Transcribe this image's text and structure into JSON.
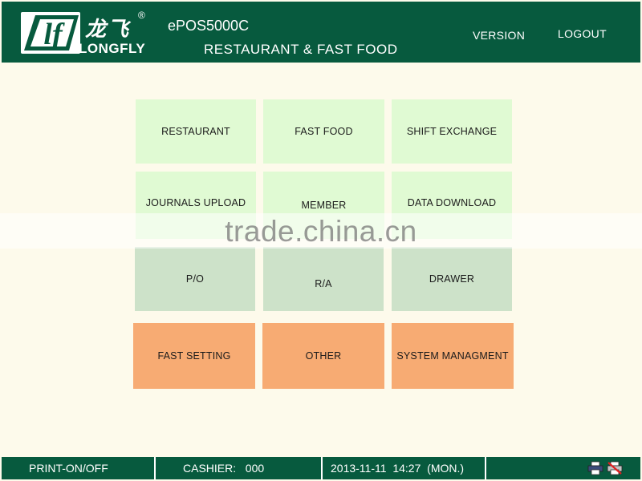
{
  "header": {
    "logo_letter": "lf",
    "logo_cn": "龙飞",
    "logo_reg": "®",
    "logo_en": "LONGFLY",
    "product": "ePOS5000C",
    "subtitle": "RESTAURANT & FAST FOOD",
    "version_label": "VERSION",
    "logout_label": "LOGOUT"
  },
  "menu": {
    "restaurant": "RESTAURANT",
    "fast_food": "FAST FOOD",
    "shift_exchange": "SHIFT EXCHANGE",
    "journals_upload": "JOURNALS UPLOAD",
    "member": "MEMBER",
    "data_download": "DATA DOWNLOAD",
    "po": "P/O",
    "ra": "R/A",
    "drawer": "DRAWER",
    "fast_setting": "FAST SETTING",
    "other": "OTHER",
    "system_management": "SYSTEM MANAGMENT"
  },
  "watermark": "trade.china.cn",
  "footer": {
    "print_label": "PRINT-ON/OFF",
    "cashier_label": "CASHIER:",
    "cashier_id": "000",
    "date": "2013-11-11",
    "time": "14:27",
    "weekday": "(MON.)",
    "icons": [
      "printer-icon",
      "printer-off-icon"
    ]
  },
  "colors": {
    "header_green": "#075a3e",
    "tile_light": "#e0fad3",
    "tile_mid": "#cde2c9",
    "tile_orange": "#f7ab73",
    "background": "#fdfaeb"
  }
}
